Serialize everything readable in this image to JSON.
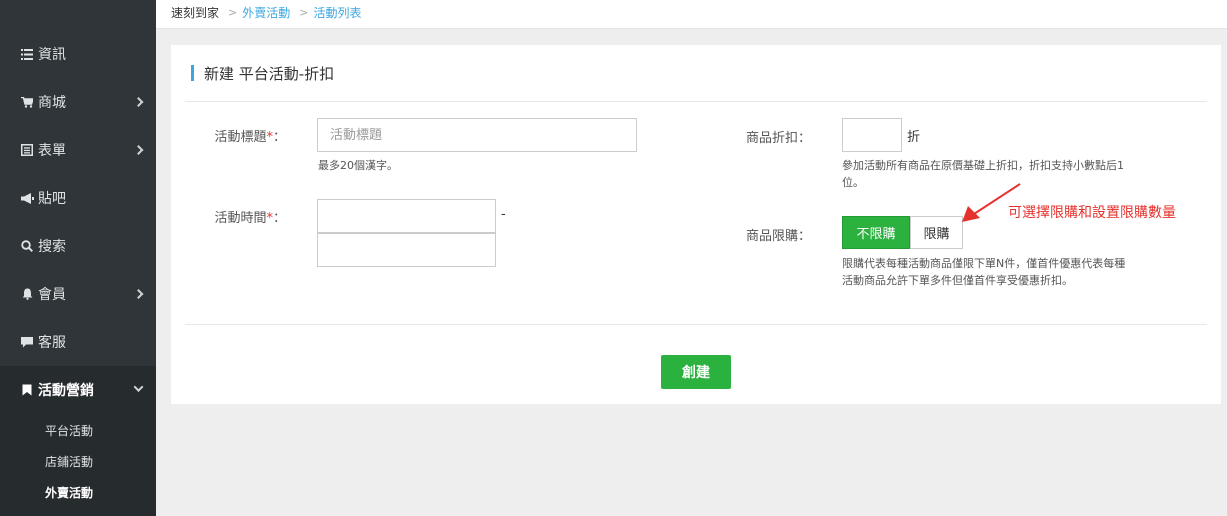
{
  "sidebar": {
    "items": [
      {
        "label": "資訊",
        "icon": "list-icon"
      },
      {
        "label": "商城",
        "icon": "cart-icon"
      },
      {
        "label": "表單",
        "icon": "form-icon"
      },
      {
        "label": "貼吧",
        "icon": "megaphone-icon"
      },
      {
        "label": "搜索",
        "icon": "search-icon"
      },
      {
        "label": "會員",
        "icon": "bell-icon"
      },
      {
        "label": "客服",
        "icon": "chat-icon"
      },
      {
        "label": "活動營銷",
        "icon": "bookmark-icon"
      }
    ],
    "submenu": [
      "平台活動",
      "店鋪活動",
      "外賣活動"
    ]
  },
  "breadcrumb": {
    "home": "速刻到家",
    "level1": "外賣活動",
    "level2": "活動列表"
  },
  "card": {
    "title": "新建 平台活動-折扣"
  },
  "form": {
    "title_label": "活動標題",
    "title_placeholder": "活動標題",
    "title_hint": "最多20個漢字。",
    "time_label": "活動時間",
    "time_separator": "-",
    "discount_label": "商品折扣：",
    "discount_unit": "折",
    "discount_hint_1": "參加活動所有商品在原價基礎上折扣，折扣支持小數點后1",
    "discount_hint_2": "位。",
    "limit_label": "商品限購：",
    "limit_option_unlimited": "不限購",
    "limit_option_limited": "限購",
    "limit_hint_1": "限購代表每種活動商品僅限下單N件，僅首件優惠代表每種",
    "limit_hint_2": "活動商品允許下單多件但僅首件享受優惠折扣。",
    "colon": "：",
    "required_mark": "*"
  },
  "actions": {
    "create_label": "創建"
  },
  "annotation": {
    "text": "可選擇限購和設置限購數量",
    "color": "#e5322d"
  },
  "colors": {
    "sidebar_bg": "#2f3538",
    "accent_blue": "#3ba6e0",
    "green": "#2ab13e"
  }
}
